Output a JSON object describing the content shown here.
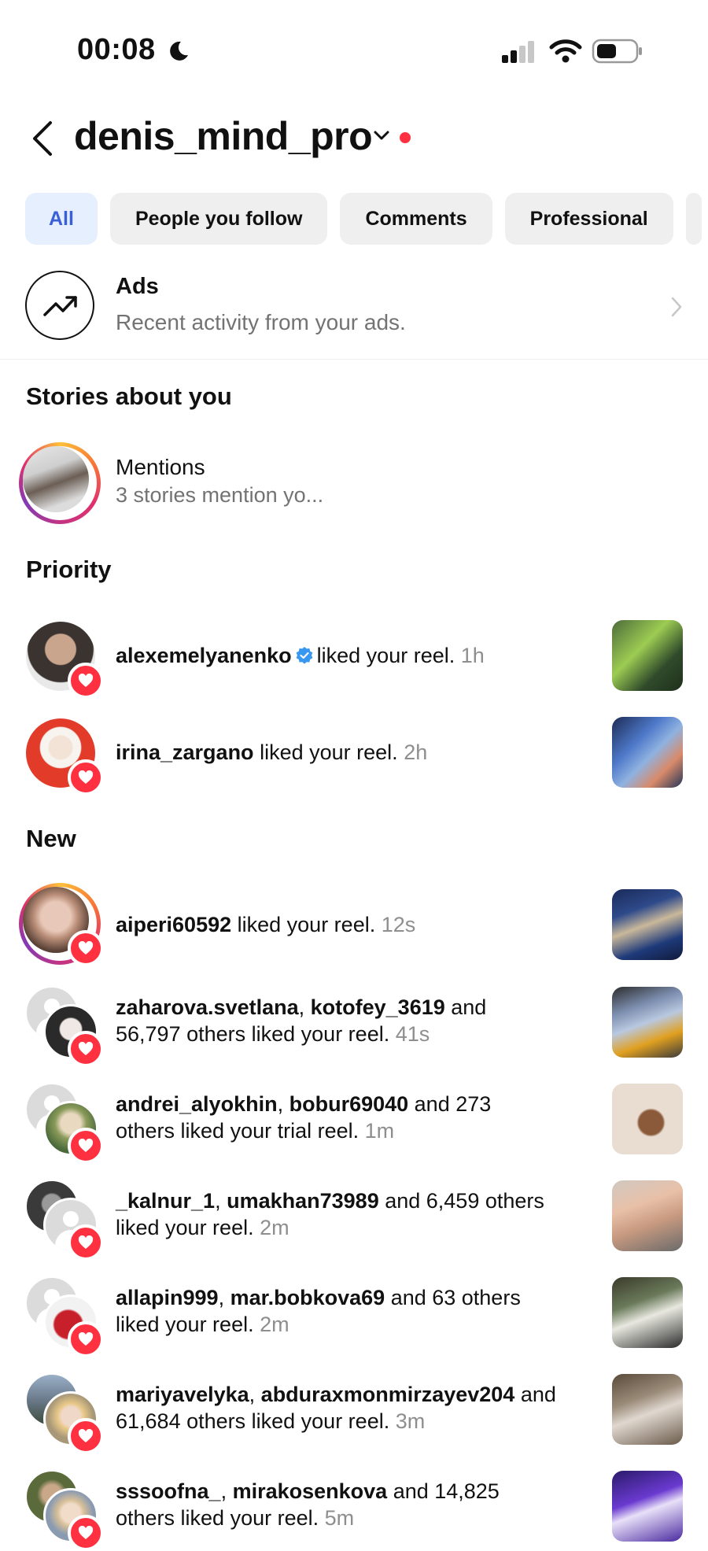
{
  "status_bar": {
    "time": "00:08"
  },
  "header": {
    "title": "denis_mind_pro"
  },
  "filters": [
    "All",
    "People you follow",
    "Comments",
    "Professional"
  ],
  "ads": {
    "title": "Ads",
    "subtitle": "Recent activity from your ads."
  },
  "sections": {
    "stories": "Stories about you",
    "priority": "Priority",
    "new": "New"
  },
  "mentions": {
    "title": "Mentions",
    "subtitle": "3 stories mention yo..."
  },
  "priority": [
    {
      "user": "alexemelyanenko",
      "verified": true,
      "action": "liked your reel.",
      "time": "1h"
    },
    {
      "user": "irina_zargano",
      "action": "liked your reel.",
      "time": "2h"
    }
  ],
  "new": [
    {
      "users": [
        "aiperi60592"
      ],
      "line1_rest": " liked your reel. ",
      "line2": "",
      "time": "12s"
    },
    {
      "users": [
        "zaharova.svetlana",
        "kotofey_3619"
      ],
      "line1_rest": " and",
      "line2": "56,797 others liked your reel. ",
      "time": "41s"
    },
    {
      "users": [
        "andrei_alyokhin",
        "bobur69040"
      ],
      "line1_rest": " and 273",
      "line2": "others liked your trial reel. ",
      "time": "1m"
    },
    {
      "users": [
        "_kalnur_1",
        "umakhan73989"
      ],
      "line1_rest": " and 6,459 others",
      "line2": "liked your reel. ",
      "time": "2m"
    },
    {
      "users": [
        "allapin999",
        "mar.bobkova69"
      ],
      "line1_rest": " and 63 others",
      "line2": "liked your reel. ",
      "time": "2m"
    },
    {
      "users": [
        "mariyavelyka",
        "abduraxmonmirzayev204"
      ],
      "line1_rest": " and",
      "line2": "61,684 others liked your reel. ",
      "time": "3m"
    },
    {
      "users": [
        "sssoofna_",
        "mirakosenkova"
      ],
      "line1_rest": " and 14,825",
      "line2": "others liked your reel. ",
      "time": "5m"
    }
  ]
}
